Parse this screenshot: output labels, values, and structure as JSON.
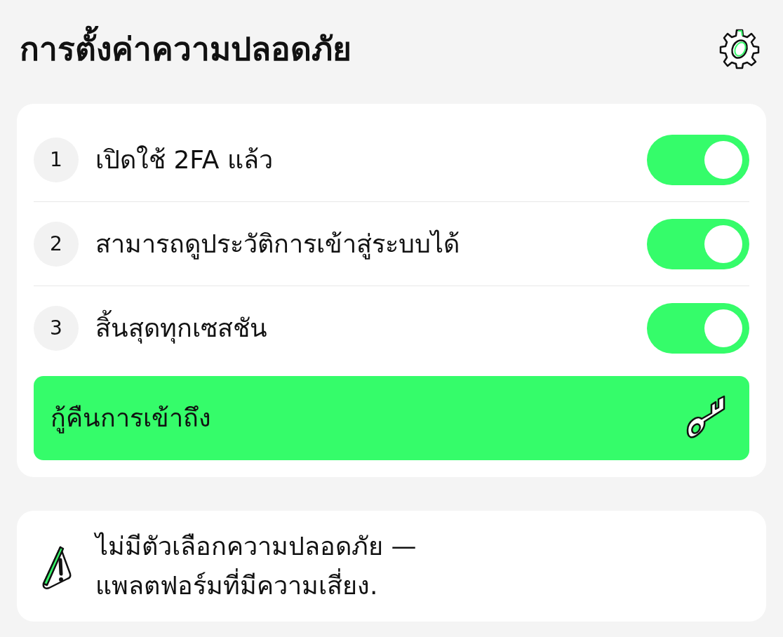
{
  "title": "การตั้งค่าความปลอดภัย",
  "settings": [
    {
      "number": "1",
      "label": "เปิดใช้ 2FA แล้ว",
      "on": true
    },
    {
      "number": "2",
      "label": "สามารถดูประวัติการเข้าสู่ระบบได้",
      "on": true
    },
    {
      "number": "3",
      "label": "สิ้นสุดทุกเซสชัน",
      "on": true
    }
  ],
  "recover_button": {
    "label": "กู้คืนการเข้าถึง"
  },
  "warning": {
    "text": "ไม่มีตัวเลือกความปลอดภัย — แพลตฟอร์มที่มีความเสี่ยง."
  }
}
